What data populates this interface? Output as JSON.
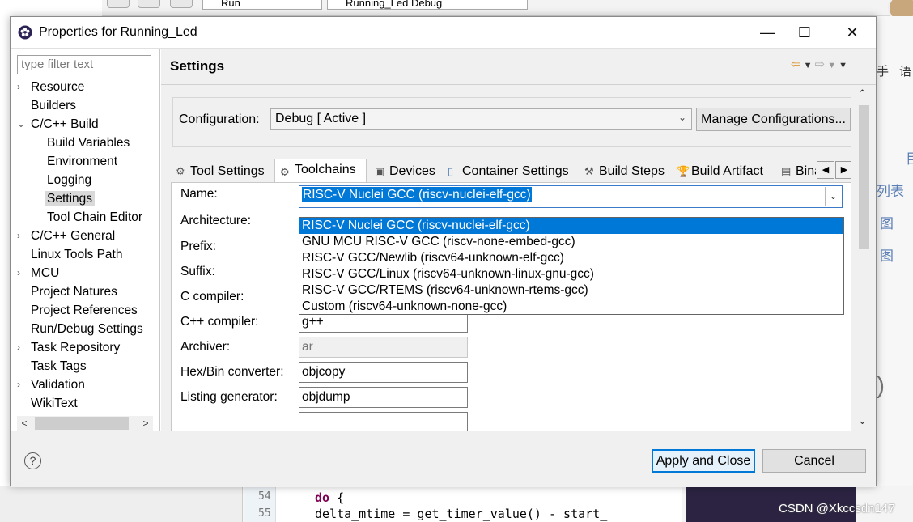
{
  "background_ide": {
    "run_combo": "Run",
    "launch_combo": "Running_Led Debug",
    "right_side_chars": [
      "手",
      "语",
      "目",
      "列表",
      "图",
      "图",
      ")"
    ],
    "editor_lines": [
      {
        "num": "54",
        "keyword": "do",
        "rest": " {"
      },
      {
        "num": "55",
        "keyword": "",
        "rest": "delta_mtime = get_timer_value() - start_"
      }
    ],
    "watermark": "CSDN @Xkccsdn147"
  },
  "dialog": {
    "title": "Properties for Running_Led",
    "window_buttons": {
      "minimize": "—",
      "maximize": "☐",
      "close": "✕"
    }
  },
  "sidebar": {
    "filter_placeholder": "type filter text",
    "items": [
      {
        "label": "Resource",
        "expandable": "›"
      },
      {
        "label": "Builders",
        "expandable": ""
      },
      {
        "label": "C/C++ Build",
        "expandable": "⌄"
      },
      {
        "label": "Build Variables",
        "expandable": ""
      },
      {
        "label": "Environment",
        "expandable": ""
      },
      {
        "label": "Logging",
        "expandable": ""
      },
      {
        "label": "Settings",
        "expandable": ""
      },
      {
        "label": "Tool Chain Editor",
        "expandable": ""
      },
      {
        "label": "C/C++ General",
        "expandable": "›"
      },
      {
        "label": "Linux Tools Path",
        "expandable": ""
      },
      {
        "label": "MCU",
        "expandable": "›"
      },
      {
        "label": "Project Natures",
        "expandable": ""
      },
      {
        "label": "Project References",
        "expandable": ""
      },
      {
        "label": "Run/Debug Settings",
        "expandable": ""
      },
      {
        "label": "Task Repository",
        "expandable": "›"
      },
      {
        "label": "Task Tags",
        "expandable": ""
      },
      {
        "label": "Validation",
        "expandable": "›"
      },
      {
        "label": "WikiText",
        "expandable": ""
      }
    ],
    "selected": "Settings"
  },
  "page": {
    "title": "Settings",
    "configuration_label": "Configuration:",
    "configuration_value": "Debug  [ Active ]",
    "manage_button": "Manage Configurations...",
    "tabs": [
      {
        "label": "Tool Settings",
        "icon": "gear-icon"
      },
      {
        "label": "Toolchains",
        "icon": "gear-icon"
      },
      {
        "label": "Devices",
        "icon": "chip-icon"
      },
      {
        "label": "Container Settings",
        "icon": "container-icon"
      },
      {
        "label": "Build Steps",
        "icon": "hammer-icon"
      },
      {
        "label": "Build Artifact",
        "icon": "trophy-icon"
      },
      {
        "label": "Binary Parsers",
        "icon": "binary-icon"
      }
    ],
    "active_tab": "Toolchains",
    "fields": [
      {
        "label": "Name:",
        "value": "RISC-V Nuclei GCC (riscv-nuclei-elf-gcc)"
      },
      {
        "label": "Architecture:",
        "value": ""
      },
      {
        "label": "Prefix:",
        "value": ""
      },
      {
        "label": "Suffix:",
        "value": ""
      },
      {
        "label": "C compiler:",
        "value": ""
      },
      {
        "label": "C++ compiler:",
        "value": "g++"
      },
      {
        "label": "Archiver:",
        "value": "ar"
      },
      {
        "label": "Hex/Bin converter:",
        "value": "objcopy"
      },
      {
        "label": "Listing generator:",
        "value": "objdump"
      }
    ],
    "toolchain_options": [
      "RISC-V Nuclei GCC (riscv-nuclei-elf-gcc)",
      "GNU MCU RISC-V GCC (riscv-none-embed-gcc)",
      "RISC-V GCC/Newlib (riscv64-unknown-elf-gcc)",
      "RISC-V GCC/Linux (riscv64-unknown-linux-gnu-gcc)",
      "RISC-V GCC/RTEMS (riscv64-unknown-rtems-gcc)",
      "Custom (riscv64-unknown-none-gcc)"
    ],
    "highlighted_option_index": 0
  },
  "footer": {
    "help": "?",
    "apply_close": "Apply and Close",
    "cancel": "Cancel"
  },
  "colors": {
    "selection": "#0078d7",
    "tree_selected": "#d9d9d9",
    "dialog_bg": "#f0f0f0"
  }
}
